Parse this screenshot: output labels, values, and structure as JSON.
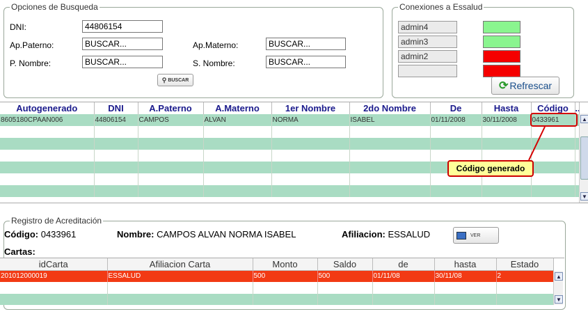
{
  "search": {
    "title": "Opciones de Busqueda",
    "dni_label": "DNI:",
    "dni_value": "44806154",
    "ap_paterno_label": "Ap.Paterno:",
    "ap_paterno_value": "BUSCAR...",
    "ap_materno_label": "Ap.Materno:",
    "ap_materno_value": "BUSCAR...",
    "p_nombre_label": "P. Nombre:",
    "p_nombre_value": "BUSCAR...",
    "s_nombre_label": "S. Nombre:",
    "s_nombre_value": "BUSCAR...",
    "buscar_label": "BUSCAR"
  },
  "connections": {
    "title": "Conexiones a Essalud",
    "items": [
      {
        "name": "admin4",
        "status_color": "#8af58f"
      },
      {
        "name": "admin3",
        "status_color": "#8af58f"
      },
      {
        "name": "admin2",
        "status_color": "#f50000"
      },
      {
        "name": "",
        "status_color": "#f50000"
      }
    ],
    "refresh_label": "Refrescar"
  },
  "results": {
    "columns": [
      "Autogenerado",
      "DNI",
      "A.Paterno",
      "A.Materno",
      "1er Nombre",
      "2do Nombre",
      "De",
      "Hasta",
      "Código",
      "..."
    ],
    "rows": [
      [
        "8605180CPAAN006",
        "44806154",
        "CAMPOS",
        "ALVAN",
        "NORMA",
        "ISABEL",
        "01/11/2008",
        "30/11/2008",
        "0433961"
      ]
    ],
    "callout": "Código generado"
  },
  "registro": {
    "title": "Registro de Acreditación",
    "codigo_label": "Código:",
    "codigo_value": "0433961",
    "nombre_label": "Nombre:",
    "nombre_value": "CAMPOS ALVAN NORMA ISABEL",
    "afiliacion_label": "Afiliacion:",
    "afiliacion_value": "ESSALUD",
    "ver_label": "VER",
    "cartas_label": "Cartas:",
    "columns": [
      "idCarta",
      "Afiliacion Carta",
      "Monto",
      "Saldo",
      "de",
      "hasta",
      "Estado"
    ],
    "rows": [
      [
        "201012000019",
        "ESSALUD",
        "500",
        "500",
        "01/11/08",
        "30/11/08",
        "2"
      ]
    ]
  },
  "colors": {
    "row_alt": "#a9dcc3",
    "selected_row": "#f23a14",
    "callout_bg": "#ffff99",
    "callout_border": "#cc0000"
  }
}
